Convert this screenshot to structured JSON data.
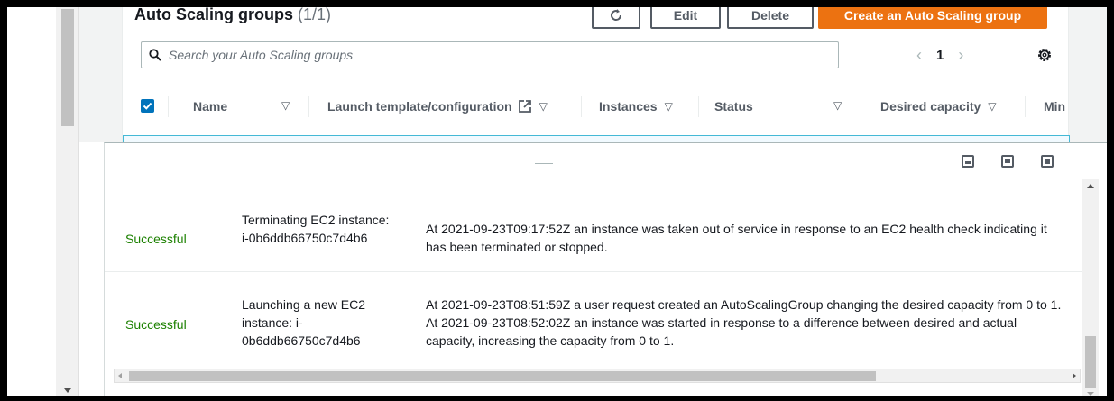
{
  "asg": {
    "title": "Auto Scaling groups",
    "count": "(1/1)",
    "edit_label": "Edit",
    "delete_label": "Delete",
    "create_label": "Create an Auto Scaling group",
    "search_placeholder": "Search your Auto Scaling groups",
    "page": "1",
    "columns": [
      "Name",
      "Launch template/configuration",
      "Instances",
      "Status",
      "Desired capacity",
      "Min"
    ]
  },
  "activity": {
    "rows": [
      {
        "status": "Successful",
        "description": "Terminating EC2 instance: i-0b6ddb66750c7d4b6",
        "cause": "At 2021-09-23T09:17:52Z an instance was taken out of service in response to an EC2 health check indicating it has been terminated or stopped."
      },
      {
        "status": "Successful",
        "description": "Launching a new EC2 instance: i-0b6ddb66750c7d4b6",
        "cause": "At 2021-09-23T08:51:59Z a user request created an AutoScalingGroup changing the desired capacity from 0 to 1. At 2021-09-23T08:52:02Z an instance was started in response to a difference between desired and actual capacity, increasing the capacity from 0 to 1."
      }
    ]
  },
  "colors": {
    "primary": "#ec7211",
    "success": "#1d8102",
    "selected": "#0073bb"
  }
}
